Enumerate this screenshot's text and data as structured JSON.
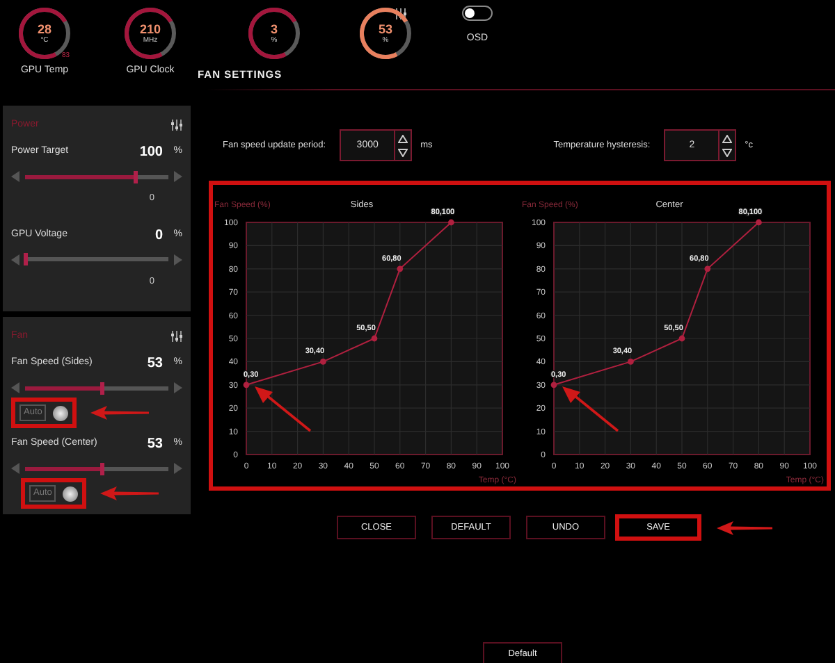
{
  "gauges": [
    {
      "value": "28",
      "unit": "°C",
      "label": "GPU Temp",
      "extra": "83"
    },
    {
      "value": "210",
      "unit": "MHz",
      "label": "GPU Clock"
    },
    {
      "value": "3",
      "unit": "%"
    },
    {
      "value": "53",
      "unit": "%"
    }
  ],
  "osd": {
    "label": "OSD",
    "on": false
  },
  "panels": [
    {
      "title": "Power",
      "sliders": [
        {
          "label": "Power Target",
          "value": "100",
          "unit": "%",
          "level": 0.77,
          "reading": "0"
        },
        {
          "label": "GPU Voltage",
          "value": "0",
          "unit": "%",
          "level": 0.0,
          "reading": "0"
        }
      ]
    },
    {
      "title": "Fan",
      "sliders": [
        {
          "label": "Fan Speed (Sides)",
          "value": "53",
          "unit": "%",
          "level": 0.53,
          "auto": {
            "label": "Auto",
            "on": false,
            "highlighted": true
          }
        },
        {
          "label": "Fan Speed (Center)",
          "value": "53",
          "unit": "%",
          "level": 0.53,
          "auto": {
            "label": "Auto",
            "on": false,
            "highlighted": true
          }
        }
      ]
    }
  ],
  "fan_settings": {
    "title": "FAN SETTINGS",
    "fields": [
      {
        "label": "Fan speed update period:",
        "value": "3000",
        "unit": "ms"
      },
      {
        "label": "Temperature hysteresis:",
        "value": "2",
        "unit": "°c"
      }
    ],
    "charts_highlighted": true,
    "charts": [
      {
        "annotation_arrow": true,
        "chart_data": {
          "type": "line",
          "title": "Sides",
          "xlabel": "Temp (°C)",
          "ylabel": "Fan Speed (%)",
          "x": [
            0,
            30,
            50,
            60,
            80
          ],
          "series": [
            {
              "color": "#b0203f",
              "marker": "circle",
              "values": [
                30,
                40,
                50,
                80,
                100
              ]
            }
          ],
          "xlim": [
            0,
            100
          ],
          "ylim": [
            0,
            100
          ],
          "xticks": [
            0,
            10,
            20,
            30,
            40,
            50,
            60,
            70,
            80,
            90,
            100
          ],
          "yticks": [
            0,
            10,
            20,
            30,
            40,
            50,
            60,
            70,
            80,
            90,
            100
          ],
          "grid": true,
          "value_labels": [
            "0,30",
            "30,40",
            "50,50",
            "60,80",
            "80,100"
          ]
        }
      },
      {
        "annotation_arrow": true,
        "chart_data": {
          "type": "line",
          "title": "Center",
          "xlabel": "Temp (°C)",
          "ylabel": "Fan Speed (%)",
          "x": [
            0,
            30,
            50,
            60,
            80
          ],
          "series": [
            {
              "color": "#b0203f",
              "marker": "circle",
              "values": [
                30,
                40,
                50,
                80,
                100
              ]
            }
          ],
          "xlim": [
            0,
            100
          ],
          "ylim": [
            0,
            100
          ],
          "xticks": [
            0,
            10,
            20,
            30,
            40,
            50,
            60,
            70,
            80,
            90,
            100
          ],
          "yticks": [
            0,
            10,
            20,
            30,
            40,
            50,
            60,
            70,
            80,
            90,
            100
          ],
          "grid": true,
          "value_labels": [
            "0,30",
            "30,40",
            "50,50",
            "60,80",
            "80,100"
          ]
        }
      }
    ],
    "buttons": [
      {
        "label": "CLOSE",
        "highlighted": false
      },
      {
        "label": "DEFAULT",
        "highlighted": false
      },
      {
        "label": "UNDO",
        "highlighted": false
      },
      {
        "label": "SAVE",
        "highlighted": true
      }
    ]
  },
  "footer_button": "Default"
}
